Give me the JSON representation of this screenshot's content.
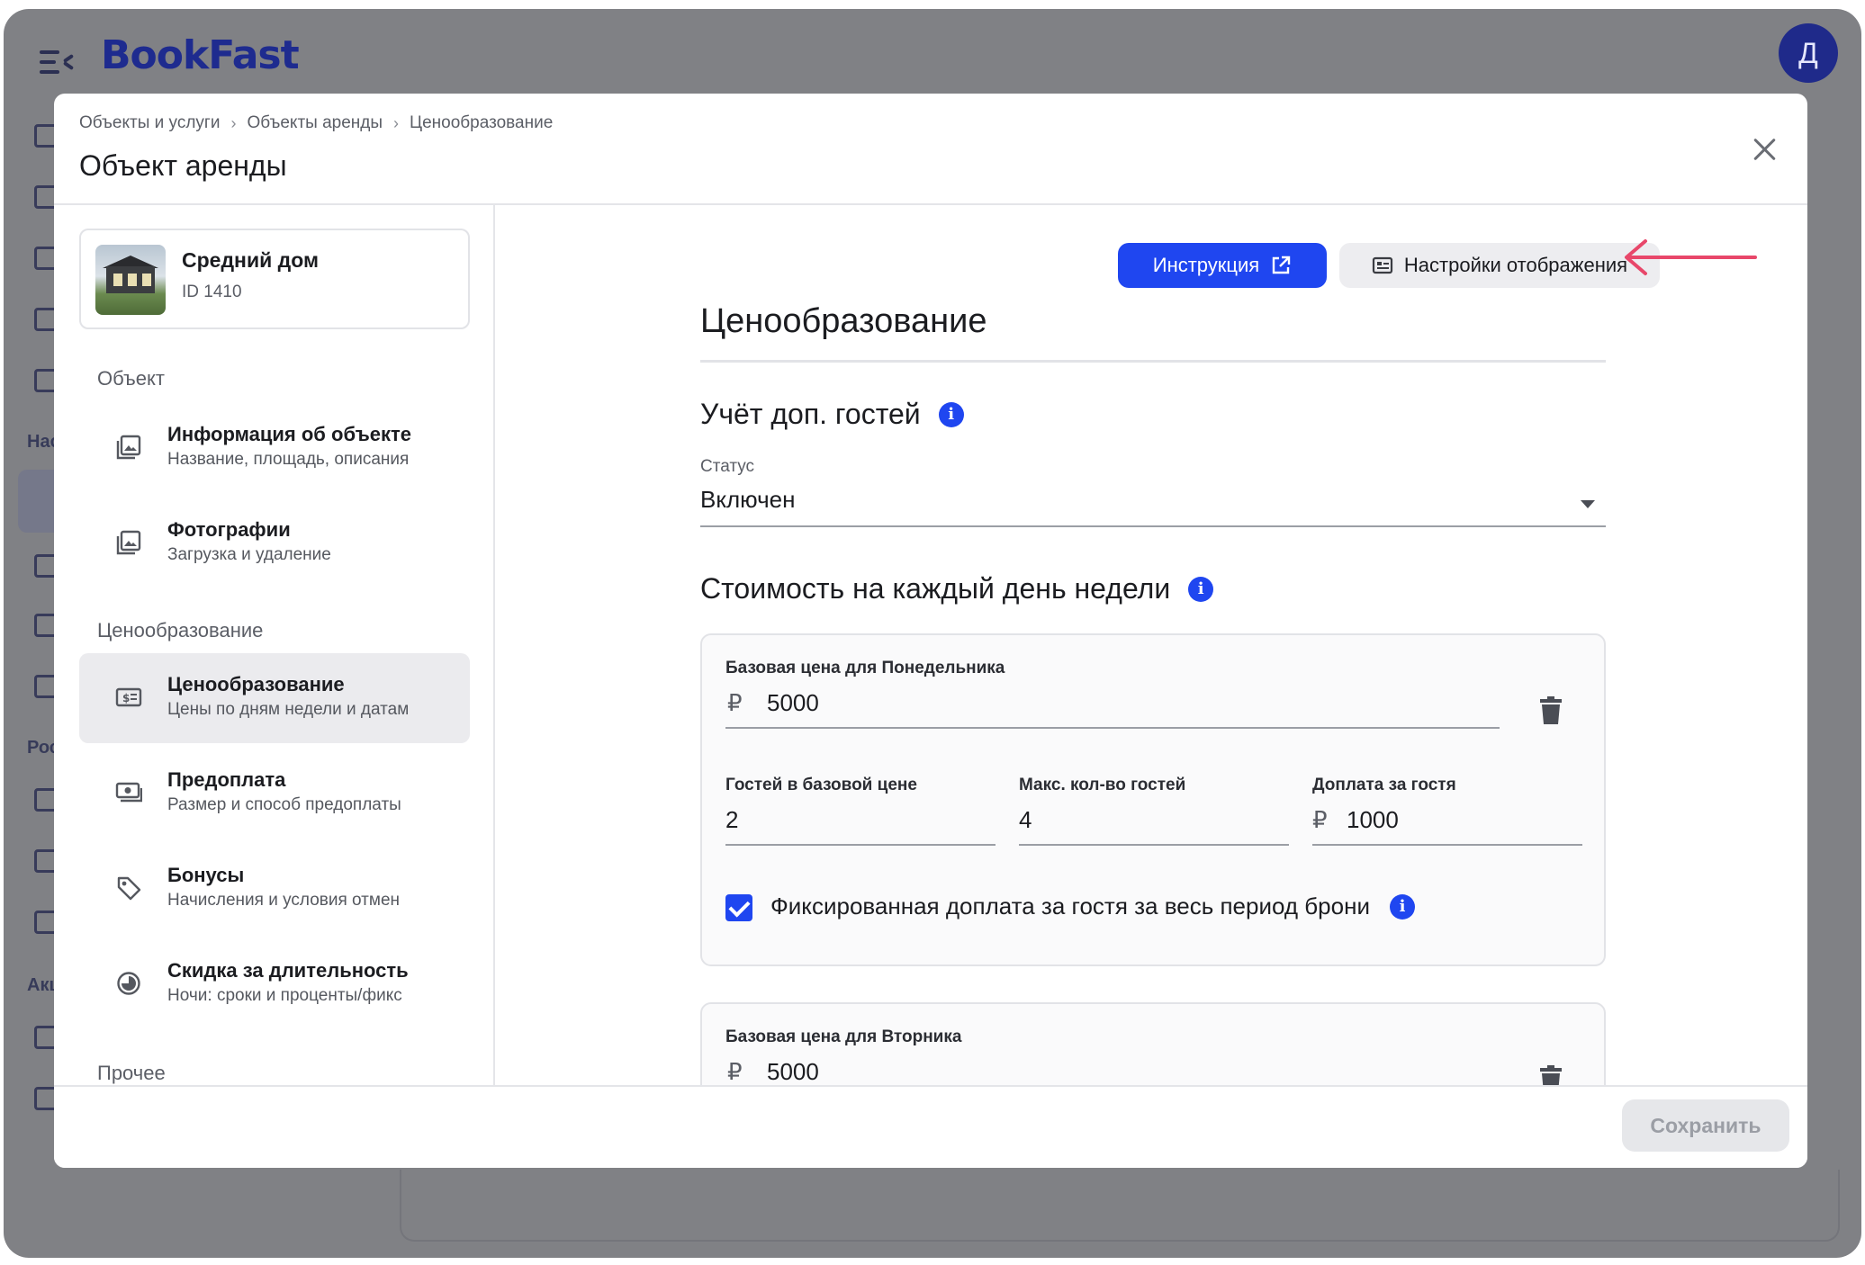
{
  "app": {
    "logo": "BookFast",
    "avatar_letter": "Д",
    "sidebar_fragments": [
      "Нас",
      "Рос",
      "Акц"
    ]
  },
  "modal": {
    "breadcrumb": [
      "Объекты и услуги",
      "Объекты аренды",
      "Ценообразование"
    ],
    "title": "Объект аренды"
  },
  "object": {
    "name": "Средний дом",
    "id": "ID 1410"
  },
  "nav": {
    "section_object": "Объект",
    "section_pricing": "Ценообразование",
    "section_other": "Прочее",
    "items": [
      {
        "title": "Информация об объекте",
        "sub": "Название, площадь, описания",
        "icon": "image-stack-icon"
      },
      {
        "title": "Фотографии",
        "sub": "Загрузка и удаление",
        "icon": "image-stack-icon"
      },
      {
        "title": "Ценообразование",
        "sub": "Цены по дням недели и датам",
        "icon": "price-tag-card-icon",
        "active": true
      },
      {
        "title": "Предоплата",
        "sub": "Размер и способ предоплаты",
        "icon": "cash-icon"
      },
      {
        "title": "Бонусы",
        "sub": "Начисления и условия отмен",
        "icon": "tag-icon"
      },
      {
        "title": "Скидка за длительность",
        "sub": "Ночи: сроки и проценты/фикс",
        "icon": "half-circle-clock-icon"
      }
    ]
  },
  "toolbar": {
    "instruction_label": "Инструкция",
    "display_settings_label": "Настройки отображения"
  },
  "pricing": {
    "heading": "Ценообразование",
    "extra_guests": {
      "heading": "Учёт доп. гостей",
      "status_label": "Статус",
      "status_value": "Включен"
    },
    "weekday_section_heading": "Стоимость на каждый день недели",
    "currency_symbol": "₽",
    "days": [
      {
        "label": "Базовая цена для Понедельника",
        "price": "5000",
        "guests_in_base_label": "Гостей в базовой цене",
        "guests_in_base": "2",
        "max_guests_label": "Макс. кол-во гостей",
        "max_guests": "4",
        "extra_fee_label": "Доплата за гостя",
        "extra_fee": "1000",
        "fixed_fee_label": "Фиксированная доплата за гостя за весь период брони",
        "fixed_fee_checked": true
      },
      {
        "label": "Базовая цена для Вторника",
        "price": "5000"
      }
    ]
  },
  "footer": {
    "save_label": "Сохранить"
  },
  "colors": {
    "accent": "#1f46f0",
    "annotation_arrow": "#e8476a",
    "backdrop": "#808185"
  }
}
